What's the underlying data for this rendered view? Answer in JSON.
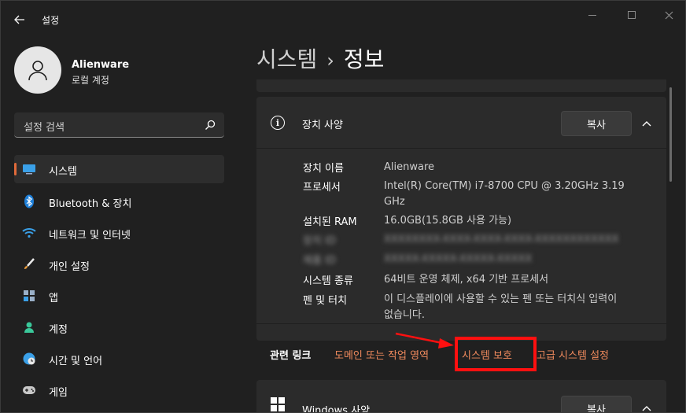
{
  "titlebar": {
    "app_title": "설정"
  },
  "profile": {
    "name": "Alienware",
    "account_type": "로컬 계정"
  },
  "search": {
    "placeholder": "설정 검색"
  },
  "sidebar": {
    "items": [
      {
        "label": "시스템",
        "icon": "system-display-icon",
        "active": true
      },
      {
        "label": "Bluetooth & 장치",
        "icon": "bluetooth-icon",
        "active": false
      },
      {
        "label": "네트워크 및 인터넷",
        "icon": "wifi-icon",
        "active": false
      },
      {
        "label": "개인 설정",
        "icon": "brush-icon",
        "active": false
      },
      {
        "label": "앱",
        "icon": "apps-icon",
        "active": false
      },
      {
        "label": "계정",
        "icon": "person-icon",
        "active": false
      },
      {
        "label": "시간 및 언어",
        "icon": "globe-clock-icon",
        "active": false
      },
      {
        "label": "게임",
        "icon": "gamepad-icon",
        "active": false
      }
    ]
  },
  "breadcrumb": {
    "parent": "시스템",
    "separator": "›",
    "current": "정보"
  },
  "device_specs": {
    "title": "장치 사양",
    "copy_label": "복사",
    "rows": [
      {
        "label": "장치 이름",
        "value": "Alienware"
      },
      {
        "label": "프로세서",
        "value": "Intel(R) Core(TM) i7-8700 CPU @ 3.20GHz   3.19 GHz"
      },
      {
        "label": "설치된 RAM",
        "value": "16.0GB(15.8GB 사용 가능)"
      },
      {
        "label": "장치 ID",
        "value": "XXXXXXXX-XXXX-XXXX-XXXX-XXXXXXXXXXXX",
        "redacted": true
      },
      {
        "label": "제품 ID",
        "value": "XXXXX-XXXXX-XXXXX-XXXXX",
        "redacted": true
      },
      {
        "label": "시스템 종류",
        "value": "64비트 운영 체제, x64 기반 프로세서"
      },
      {
        "label": "펜 및 터치",
        "value": "이 디스플레이에 사용할 수 있는 펜 또는 터치식 입력이 없습니다."
      }
    ]
  },
  "related_links": {
    "label": "관련 링크",
    "links": [
      {
        "label": "도메인 또는 작업 영역"
      },
      {
        "label": "시스템 보호"
      },
      {
        "label": "고급 시스템 설정"
      }
    ]
  },
  "windows_specs": {
    "title": "Windows 사양",
    "copy_label": "복사"
  },
  "colors": {
    "accent": "#e06a3a",
    "link": "#f08a5d",
    "highlight": "#ff1010",
    "background": "#202020",
    "card": "#2b2b2b"
  }
}
